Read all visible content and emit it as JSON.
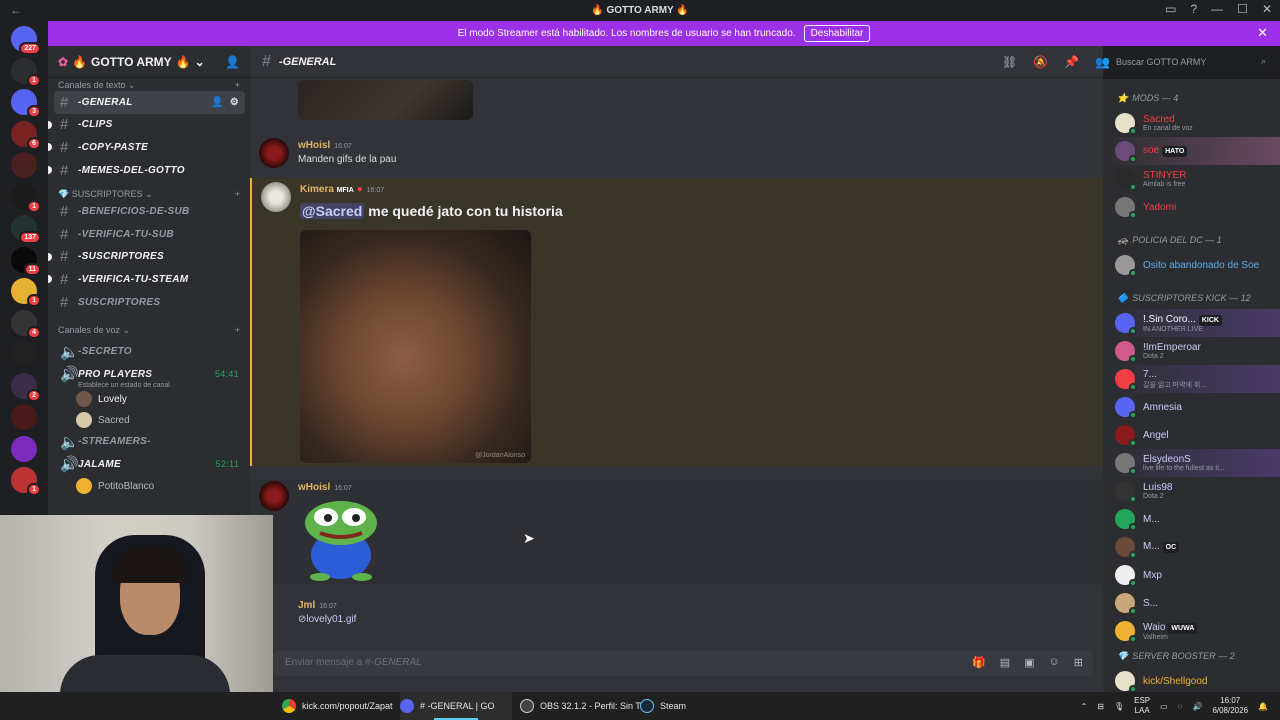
{
  "window": {
    "title": "GOTTO ARMY"
  },
  "banner": {
    "text": "El modo Streamer está habilitado. Los nombres de usuario se han truncado.",
    "button": "Deshabilitar"
  },
  "servers": [
    {
      "badge": "227"
    },
    {
      "badge": "1"
    },
    {
      "badge": "3"
    },
    {
      "badge": "6"
    },
    {
      "badge": ""
    },
    {
      "badge": "1"
    },
    {
      "badge": "137"
    },
    {
      "badge": "11"
    },
    {
      "badge": "1"
    },
    {
      "badge": "4"
    },
    {
      "badge": ""
    },
    {
      "badge": "2"
    },
    {
      "badge": ""
    },
    {
      "badge": ""
    },
    {
      "badge": "1"
    }
  ],
  "sidebar": {
    "server_name": "GOTTO ARMY",
    "text_category": "Canales de texto",
    "text_channels": [
      {
        "name": "-GENERAL",
        "active": true
      },
      {
        "name": "-CLIPS"
      },
      {
        "name": "-COPY-PASTE"
      },
      {
        "name": "-MEMES-DEL-GOTTO"
      }
    ],
    "sub_category": "SUSCRIPTORES",
    "sub_channels": [
      {
        "name": "-BENEFICIOS-DE-SUB"
      },
      {
        "name": "-VERIFICA-TU-SUB"
      },
      {
        "name": "-SUSCRIPTORES"
      },
      {
        "name": "-VERIFICA-TU-STEAM"
      },
      {
        "name": "SUSCRIPTORES"
      }
    ],
    "voice_category": "Canales de voz",
    "voice_channels": {
      "secreto": "-SECRETO",
      "pro_players": "PRO PLAYERS",
      "pro_players_time": "54:41",
      "pro_players_status": "Establece un estado de canal",
      "users": [
        "Lovely",
        "Sacred"
      ],
      "streamers": "-STREAMERS-",
      "jalame": "JALAME",
      "jalame_time": "52:11",
      "jalame_user": "PotitoBlanco"
    }
  },
  "header": {
    "channel": "-GENERAL",
    "search_placeholder": "Buscar GOTTO ARMY"
  },
  "messages": [
    {
      "author": "wHoisl",
      "time": "16:07",
      "text": "Manden gifs de la pau"
    },
    {
      "author": "Kimera",
      "tag": "MFIA",
      "time": "16:07",
      "mention": "@Sacred",
      "text": " me quedé jato con tu historia",
      "watermark": "@JordanAlonso"
    },
    {
      "author": "wHoisl",
      "time": "16:07"
    },
    {
      "author": "Jml",
      "time": "16:07",
      "attachment": "lovely01.gif"
    }
  ],
  "composer": {
    "placeholder": "Enviar mensaje a #",
    "channel": "-GENERAL"
  },
  "members": {
    "mods_header": "MODS — 4",
    "mods": [
      {
        "name": "Sacred",
        "sub": "En canal de voz",
        "color": "#f23f43"
      },
      {
        "name": "soe",
        "tag": "HATO",
        "color": "#f23f43"
      },
      {
        "name": "STINYER",
        "sub": "Aimlab is free",
        "color": "#f23f43"
      },
      {
        "name": "Yadomi",
        "color": "#f23f43"
      }
    ],
    "policia_header": "POLICIA DEL DC — 1",
    "policia": [
      {
        "name": "Osito abandonado de Soe",
        "color": "#5ab0f0"
      }
    ],
    "subs_header": "SUSCRIPTORES KICK — 12",
    "subs": [
      {
        "name": "!.Sin Coro...",
        "tag": "KICK",
        "sub": "IN ANOTHER LIVE",
        "color": "#ffffff"
      },
      {
        "name": "!ImEmperoar",
        "sub": "Dota 2",
        "color": "#c9cdfb"
      },
      {
        "name": "7...",
        "sub": "길을 잃고 마약에 취...",
        "color": "#c9cdfb"
      },
      {
        "name": "Amnesia",
        "color": "#c9cdfb"
      },
      {
        "name": "Angel",
        "color": "#c9cdfb"
      },
      {
        "name": "ElsydeonS",
        "sub": "live life to the fullest as ti...",
        "color": "#c9cdfb"
      },
      {
        "name": "Luis98",
        "sub": "Dota 2",
        "color": "#c9cdfb"
      },
      {
        "name": "M...",
        "color": "#c9cdfb"
      },
      {
        "name": "M...",
        "tag": "OC",
        "color": "#c9cdfb"
      },
      {
        "name": "Mxp",
        "color": "#c9cdfb"
      },
      {
        "name": "S...",
        "color": "#c9cdfb"
      },
      {
        "name": "Waio",
        "tag": "WUWA",
        "sub": "Valheim",
        "color": "#c9cdfb"
      }
    ],
    "booster_header": "SERVER BOOSTER — 2",
    "booster": [
      {
        "name": "kick/Shellgood",
        "color": "#f0b232"
      }
    ]
  },
  "taskbar": {
    "items": [
      "kick.com/popout/Zapat",
      "# -GENERAL | GO",
      "OBS 32.1.2 - Perfil: Sin Tí",
      "Steam"
    ],
    "lang": "ESP",
    "lang2": "LAA",
    "time": "16:07",
    "date": "6/08/2026"
  },
  "colors": {
    "accent": "#9b30e6",
    "mention": "#f0b232",
    "online": "#23a55a"
  }
}
